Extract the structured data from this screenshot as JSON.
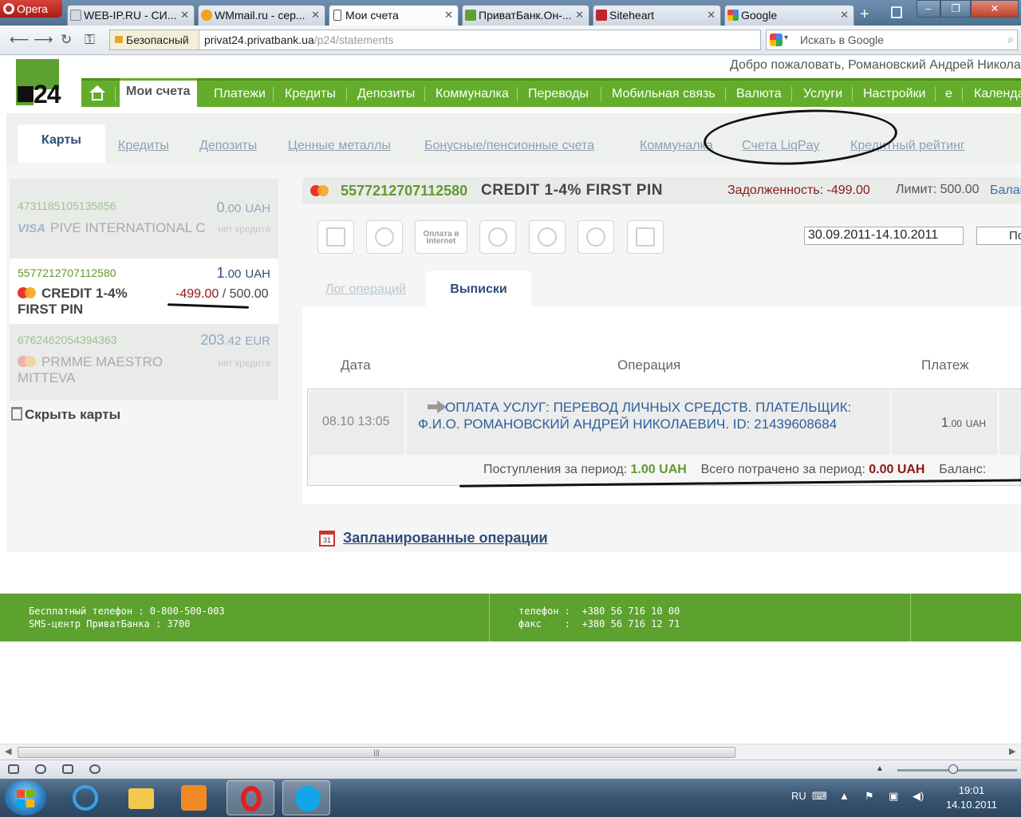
{
  "browser": {
    "menu_label": "Opera",
    "tabs": [
      {
        "label": "WEB-IP.RU - СИ...",
        "icon": "globe-icon"
      },
      {
        "label": "WMmail.ru - сер...",
        "icon": "wmmail-icon"
      },
      {
        "label": "Мои счета",
        "icon": "page-icon"
      },
      {
        "label": "ПриватБанк.Он-...",
        "icon": "privatbank-icon"
      },
      {
        "label": "Siteheart",
        "icon": "siteheart-icon"
      },
      {
        "label": "Google",
        "icon": "google-icon"
      }
    ],
    "secure_label": "Безопасный",
    "url_domain": "privat24.privatbank.ua",
    "url_path": "/p24/statements",
    "search_placeholder": "Искать в Google"
  },
  "header": {
    "logo_text": "24",
    "welcome": "Добро пожаловать, Романовский Андрей Николае"
  },
  "main_menu": [
    "Мои счета",
    "Платежи",
    "Кредиты",
    "Депозиты",
    "Коммуналка",
    "Переводы",
    "Мобильная связь",
    "Валюта",
    "Услуги",
    "Настройки",
    "e",
    "Календа"
  ],
  "sub_menu": [
    "Карты",
    "Кредиты",
    "Депозиты",
    "Ценные металлы",
    "Бонусные/пенсионные счета",
    "Коммуналка",
    "Счета LiqPay",
    "Кредитный рейтинг"
  ],
  "cards": [
    {
      "number": "4731185105135856",
      "balance_int": "0",
      "balance_frac": ".00",
      "currency": "UAH",
      "name": "PIVE INTERNATIONAL C",
      "brand": "VISA",
      "credit_note": "нет кредита"
    },
    {
      "number": "5577212707112580",
      "balance_int": "1",
      "balance_frac": ".00",
      "currency": "UAH",
      "name": "CREDIT 1-4% FIRST PIN",
      "debt": "-499.00",
      "limit": "500.00"
    },
    {
      "number": "6762462054394363",
      "balance_int": "203",
      "balance_frac": ".42",
      "currency": "EUR",
      "name": "PRMME MAESTRO MITTEVA",
      "credit_note": "нет кредита"
    }
  ],
  "hide_cards": "Скрыть карты",
  "card_header": {
    "number": "5577212707112580",
    "name": "CREDIT 1-4% FIRST PIN",
    "debt": "Задолженность: -499.00",
    "limit": "Лимит: 500.00",
    "balance": "Балан"
  },
  "tools": [
    "excel-icon",
    "refresh-icon",
    "internet-payment-icon",
    "piggy-bank-icon",
    "money-bag-icon",
    "chart-icon",
    "facebook-icon"
  ],
  "tool_internet_label": "Оплата в Internet",
  "period": "30.09.2011-14.10.2011",
  "period_button": "По",
  "tabs": {
    "log": "Лог операций",
    "statements": "Выписки"
  },
  "table": {
    "headers": [
      "Дата",
      "Операция",
      "Платеж"
    ],
    "rows": [
      {
        "date": "08.10 13:05",
        "operation": "ОПЛАТА УСЛУГ: ПЕРЕВОД ЛИЧНЫХ СРЕДСТВ. ПЛАТЕЛЬЩИК: Ф.И.О. РОМАНОВСКИЙ АНДРЕЙ НИКОЛАЕВИЧ. ID: 21439608684",
        "amount_int": "1",
        "amount_frac": ".00",
        "currency": "UAH"
      }
    ],
    "summary": {
      "income_label": "Поступления за период:",
      "income": "1.00 UAH",
      "spent_label": "Всего потрачено за период:",
      "spent": "0.00 UAH",
      "balance_label": "Баланс:"
    }
  },
  "planned_ops": "Запланированные операции",
  "calendar_day": "31",
  "footer": {
    "left": "Бесплатный телефон : 0-800-500-003\nSMS-центр ПриватБанка : 3700",
    "right": "телефон :  +380 56 716 10 00\nфакс    :  +380 56 716 12 71"
  },
  "taskbar": {
    "lang": "RU",
    "time": "19:01",
    "date": "14.10.2011",
    "apps": [
      "internet-explorer-icon",
      "folder-icon",
      "media-player-icon",
      "opera-icon",
      "skype-icon"
    ]
  }
}
